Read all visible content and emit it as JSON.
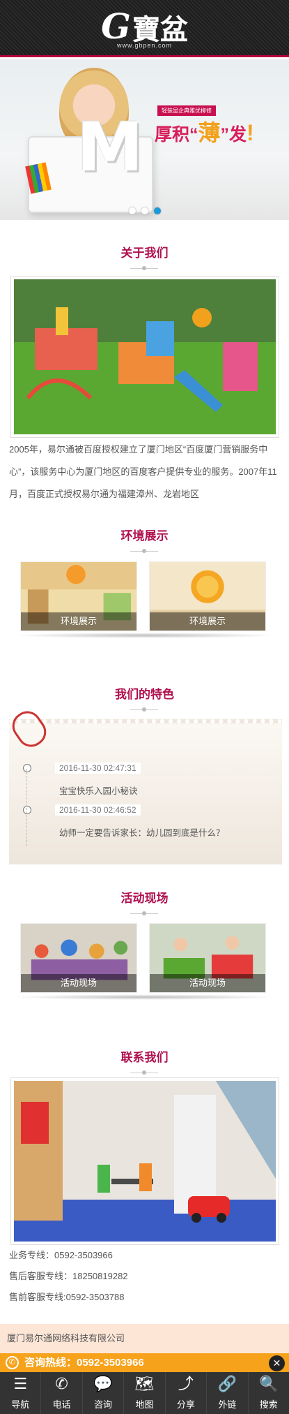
{
  "header": {
    "logo_g": "G",
    "logo_text": "寶盆",
    "logo_url": "www.gbpen.com"
  },
  "banner": {
    "tag": "轻装显企典雅优柳修",
    "slogan_a": "厚积“",
    "slogan_b": "薄",
    "slogan_c": "”发",
    "slogan_mark": "!",
    "letter": "M",
    "dots": 3,
    "active_dot": 3
  },
  "about": {
    "title": "关于我们",
    "text": "2005年，易尔通被百度授权建立了厦门地区“百度厦门营销服务中心”，该服务中心为厦门地区的百度客户提供专业的服务。2007年11月，百度正式授权易尔通为福建漳州、龙岩地区"
  },
  "env": {
    "title": "环境展示",
    "cards": [
      {
        "caption": "环境展示"
      },
      {
        "caption": "环境展示"
      }
    ]
  },
  "features": {
    "title": "我们的特色",
    "items": [
      {
        "date": "2016-11-30 02:47:31",
        "title": "宝宝快乐入园小秘诀"
      },
      {
        "date": "2016-11-30 02:46:52",
        "title": "幼师一定要告诉家长：幼儿园到底是什么？"
      }
    ]
  },
  "activity": {
    "title": "活动现场",
    "cards": [
      {
        "caption": "活动现场"
      },
      {
        "caption": "活动现场"
      }
    ]
  },
  "contact": {
    "title": "联系我们",
    "lines": [
      "业务专线：0592-3503966",
      "售后客服专线：18250819282",
      "售前客服专线:0592-3503788"
    ]
  },
  "footer": {
    "company": "厦门易尔通网络科技有限公司",
    "hotline": "咨询热线：0592-3503966",
    "close": "✕"
  },
  "nav": [
    {
      "icon": "menu-icon",
      "glyph": "☰",
      "label": "导航"
    },
    {
      "icon": "phone-icon",
      "glyph": "✆",
      "label": "电话"
    },
    {
      "icon": "chat-icon",
      "glyph": "💬",
      "label": "咨询"
    },
    {
      "icon": "map-icon",
      "glyph": "🗺",
      "label": "地图"
    },
    {
      "icon": "share-icon",
      "glyph": "⤴",
      "label": "分享"
    },
    {
      "icon": "link-icon",
      "glyph": "🔗",
      "label": "外链"
    },
    {
      "icon": "search-icon",
      "glyph": "🔍",
      "label": "搜索"
    }
  ],
  "colors": {
    "brand": "#b0104f",
    "hotline_bg": "#f7a21b",
    "footer_bg": "#fde6d6",
    "nav_bg": "#333333",
    "active_dot": "#1a9ad6"
  }
}
